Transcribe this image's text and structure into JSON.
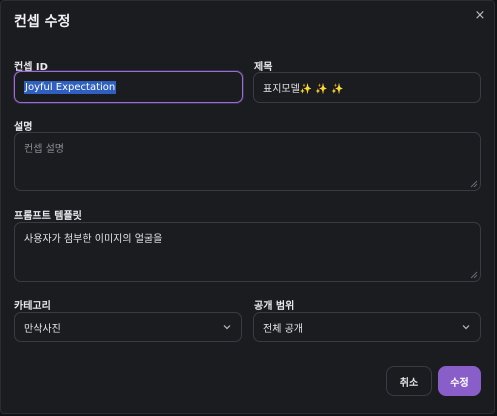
{
  "dialog": {
    "title": "컨셉 수정",
    "close_glyph": "×"
  },
  "fields": {
    "concept_id": {
      "label": "컨셉 ID",
      "value": "Joyful Expectation"
    },
    "title": {
      "label": "제목",
      "value": "표지모델✨ ✨ ✨"
    },
    "description": {
      "label": "설명",
      "placeholder": "컨셉 설명",
      "value": ""
    },
    "prompt_template": {
      "label": "프롬프트 템플릿",
      "value": "사용자가 첨부한 이미지의 얼굴을"
    },
    "category": {
      "label": "카테고리",
      "selected": "만삭사진"
    },
    "visibility": {
      "label": "공개 범위",
      "selected": "전체 공개"
    }
  },
  "buttons": {
    "cancel_label": "취소",
    "submit_label": "수정"
  },
  "colors": {
    "accent": "#8a5ec9",
    "focus_ring": "#9b6bd8",
    "selection": "#2f5fbf",
    "background": "#1b1c20"
  },
  "icons": {
    "close": "close-icon",
    "chevron": "chevron-down-icon",
    "resize": "resize-grip-icon"
  }
}
